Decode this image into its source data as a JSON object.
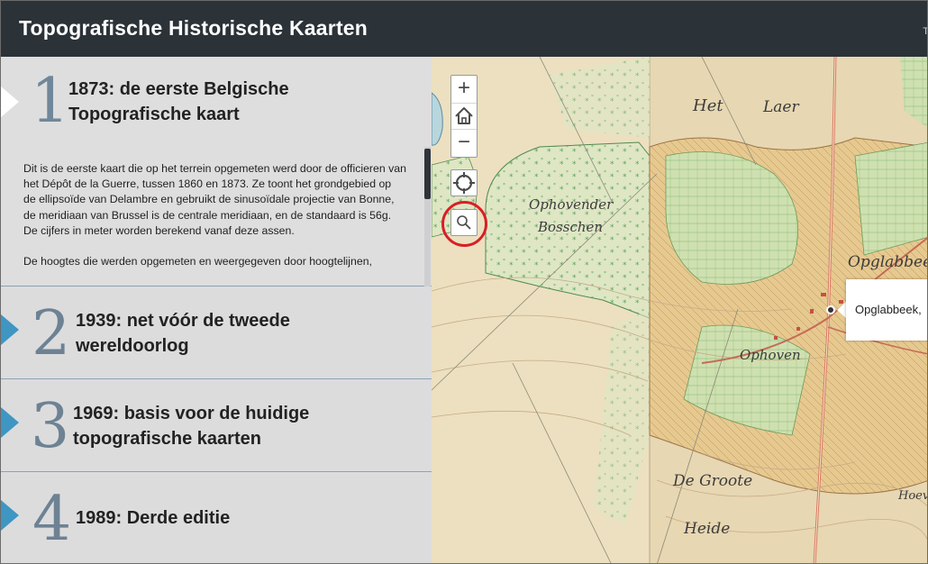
{
  "header": {
    "title": "Topografische Historische Kaarten",
    "corner_text": "T"
  },
  "sections": [
    {
      "number": "1",
      "title": "1873: de eerste Belgische Topografische kaart",
      "paragraphs": [
        "Dit is de eerste kaart die op het terrein opgemeten werd door de officieren van het Dépôt de la Guerre, tussen 1860 en 1873. Ze toont het grondgebied op de ellipsoïde van Delambre en gebruikt de sinusoïdale projectie van Bonne, de meridiaan van Brussel is de centrale meridiaan, en de standaard is 56g. De cijfers in meter worden berekend vanaf deze assen.",
        "De hoogtes die werden opgemeten en weergegeven door hoogtelijnen,"
      ]
    },
    {
      "number": "2",
      "title": "1939: net vóór de tweede wereldoorlog"
    },
    {
      "number": "3",
      "title": "1969: basis voor de huidige topografische kaarten"
    },
    {
      "number": "4",
      "title": "1989: Derde editie"
    }
  ],
  "map": {
    "controls": {
      "zoom_in": "+",
      "home": "home",
      "zoom_out": "−"
    },
    "labels": {
      "het": "Het",
      "laer": "Laer",
      "ophovender": "Ophovender",
      "bosschen": "Bosschen",
      "opglabbeek_map": "Opglabbeek",
      "ophoven": "Ophoven",
      "de_groote": "De Groote",
      "heide": "Heide",
      "hoeve": "Hoeve"
    },
    "popup_text": "Opglabbeek,"
  },
  "colors": {
    "header_bg": "#2b3238",
    "panel_bg": "#dcdcdd",
    "accent": "#3f96c3",
    "highlight_ring": "#d81f26"
  }
}
